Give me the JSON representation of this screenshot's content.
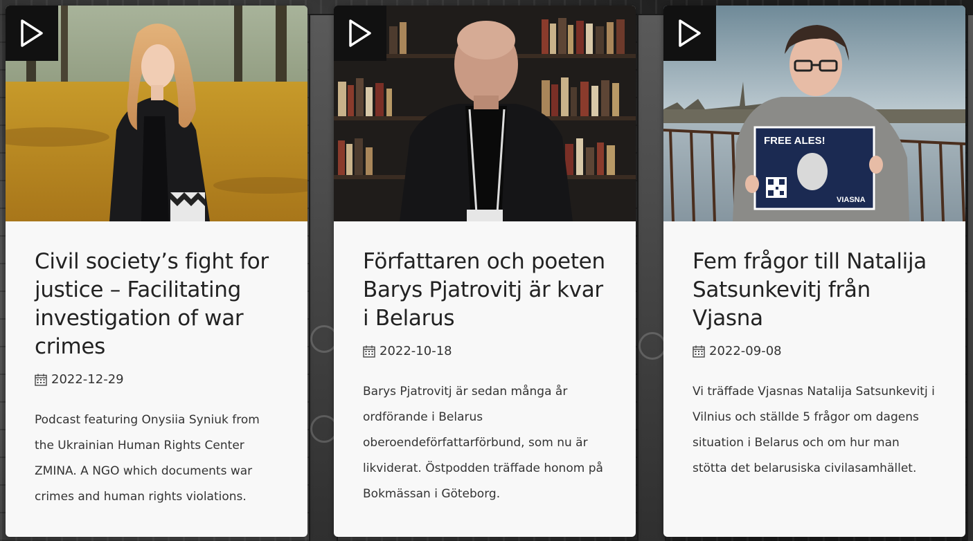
{
  "cards": [
    {
      "title": "Civil society’s fight for justice – Facilitating investigation of war crimes",
      "date": "2022-12-29",
      "description": "Podcast featuring Onysiia Syniuk from the Ukrainian Human Rights Center ZMINA. A NGO which documents war crimes and human rights violations."
    },
    {
      "title": "Författaren och poeten Barys Pjatrovitj är kvar i Belarus",
      "date": "2022-10-18",
      "description": "Barys Pjatrovitj är sedan många år ordförande i Belarus oberoendeförfattarförbund, som nu är likviderat. Östpodden träffade honom på Bokmässan i Göteborg."
    },
    {
      "title": "Fem frågor till Natalija Satsunkevitj från Vjasna",
      "date": "2022-09-08",
      "description": "Vi träffade Vjasnas Natalija Satsunkevitj i Vilnius och ställde 5 frågor om dagens situation i Belarus och om hur man stötta det belarusiska civilasamhället.",
      "sign": {
        "heading": "FREE ALES!",
        "brand": "VIASNA"
      }
    }
  ],
  "icons": {
    "play": "play-icon",
    "calendar": "calendar-icon"
  },
  "colors": {
    "card_bg": "#f8f8f8",
    "play_bg": "#111111",
    "title_text": "#222222",
    "body_text": "#333333"
  }
}
